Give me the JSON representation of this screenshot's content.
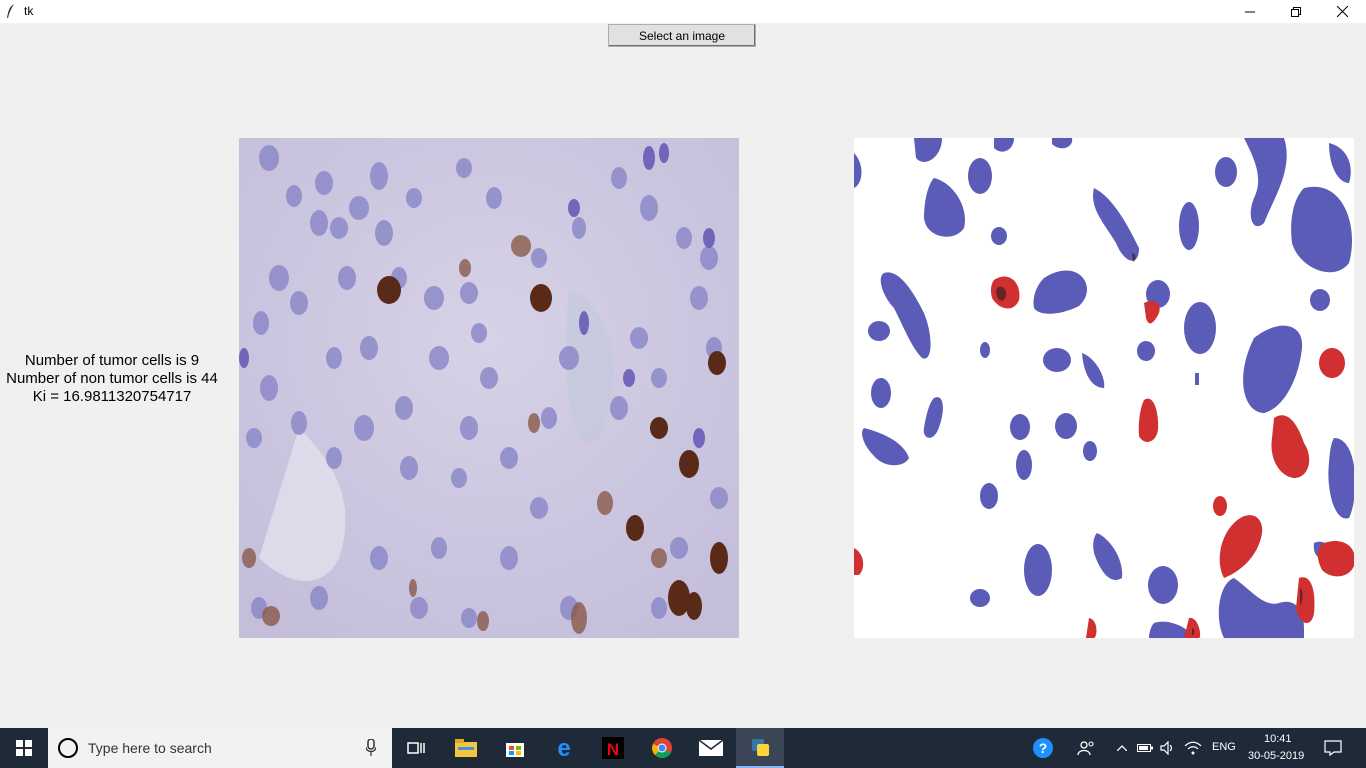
{
  "window": {
    "title": "tk"
  },
  "toolbar": {
    "select_label": "Select an image"
  },
  "stats": {
    "tumor_line": "Number of tumor cells is 9",
    "non_tumor_line": "Number of non tumor cells is 44",
    "ki_line": "Ki = 16.9811320754717"
  },
  "colors": {
    "tumor": "#d03030",
    "non_tumor": "#5a5cb8",
    "tissue_bg": "#cdc8e0",
    "stain_blue": "#8a86c8",
    "stain_brown": "#5a2a18"
  },
  "images": {
    "original": "histology-slide",
    "segmented": "segmentation-map"
  },
  "taskbar": {
    "search_placeholder": "Type here to search",
    "language": "ENG",
    "time": "10:41",
    "date": "30-05-2019",
    "apps": [
      "task-view-icon",
      "file-explorer-icon",
      "store-icon",
      "edge-icon",
      "netflix-icon",
      "chrome-icon",
      "mail-icon",
      "python-icon"
    ]
  }
}
